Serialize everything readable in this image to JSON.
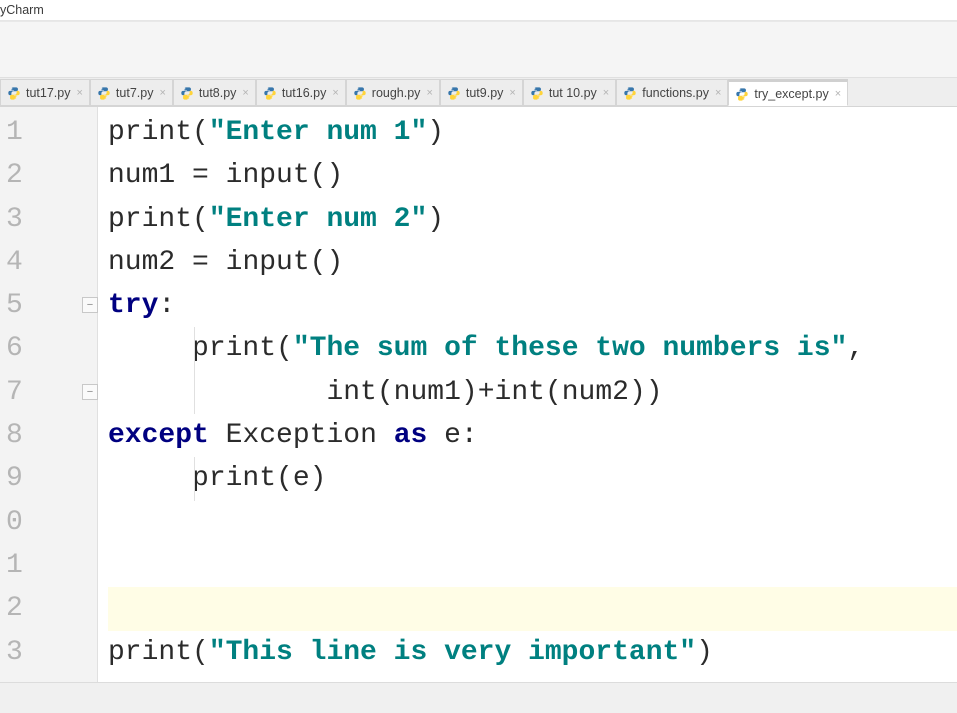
{
  "app": {
    "title": "yCharm"
  },
  "tabs": [
    {
      "label": "tut17.py",
      "active": false
    },
    {
      "label": "tut7.py",
      "active": false
    },
    {
      "label": "tut8.py",
      "active": false
    },
    {
      "label": "tut16.py",
      "active": false
    },
    {
      "label": "rough.py",
      "active": false
    },
    {
      "label": "tut9.py",
      "active": false
    },
    {
      "label": "tut 10.py",
      "active": false
    },
    {
      "label": "functions.py",
      "active": false
    },
    {
      "label": "try_except.py",
      "active": true
    }
  ],
  "close_glyph": "×",
  "fold_glyph": "−",
  "editor": {
    "current_line_index": 11,
    "line_numbers": [
      "1",
      "2",
      "3",
      "4",
      "5",
      "6",
      "7",
      "8",
      "9",
      "0",
      "1",
      "2",
      "3"
    ],
    "fold_markers": [
      4,
      6
    ],
    "lines": [
      {
        "tokens": [
          {
            "t": "print",
            "c": "id"
          },
          {
            "t": "(",
            "c": "pn"
          },
          {
            "t": "\"Enter num 1\"",
            "c": "str"
          },
          {
            "t": ")",
            "c": "pn"
          }
        ]
      },
      {
        "tokens": [
          {
            "t": "num1 ",
            "c": "id"
          },
          {
            "t": "=",
            "c": "op"
          },
          {
            "t": " ",
            "c": "id"
          },
          {
            "t": "input",
            "c": "id"
          },
          {
            "t": "()",
            "c": "pn"
          }
        ]
      },
      {
        "tokens": [
          {
            "t": "print",
            "c": "id"
          },
          {
            "t": "(",
            "c": "pn"
          },
          {
            "t": "\"Enter num 2\"",
            "c": "str"
          },
          {
            "t": ")",
            "c": "pn"
          }
        ]
      },
      {
        "tokens": [
          {
            "t": "num2 ",
            "c": "id"
          },
          {
            "t": "=",
            "c": "op"
          },
          {
            "t": " ",
            "c": "id"
          },
          {
            "t": "input",
            "c": "id"
          },
          {
            "t": "()",
            "c": "pn"
          }
        ]
      },
      {
        "tokens": [
          {
            "t": "try",
            "c": "kw"
          },
          {
            "t": ":",
            "c": "pn"
          }
        ]
      },
      {
        "indent": 1,
        "guide": true,
        "tokens": [
          {
            "t": "print",
            "c": "id"
          },
          {
            "t": "(",
            "c": "pn"
          },
          {
            "t": "\"The sum of these two numbers is\"",
            "c": "str"
          },
          {
            "t": ",",
            "c": "pn"
          }
        ]
      },
      {
        "indent": 1,
        "guide": true,
        "extra_indent": "        ",
        "tokens": [
          {
            "t": "int",
            "c": "id"
          },
          {
            "t": "(",
            "c": "pn"
          },
          {
            "t": "num1",
            "c": "id"
          },
          {
            "t": ")",
            "c": "pn"
          },
          {
            "t": "+",
            "c": "op"
          },
          {
            "t": "int",
            "c": "id"
          },
          {
            "t": "(",
            "c": "pn"
          },
          {
            "t": "num2",
            "c": "id"
          },
          {
            "t": ")",
            "c": "pn"
          },
          {
            "t": ")",
            "c": "pn"
          }
        ]
      },
      {
        "tokens": [
          {
            "t": "except",
            "c": "kw"
          },
          {
            "t": " ",
            "c": "id"
          },
          {
            "t": "Exception",
            "c": "cls"
          },
          {
            "t": " ",
            "c": "id"
          },
          {
            "t": "as",
            "c": "kw"
          },
          {
            "t": " e",
            "c": "id"
          },
          {
            "t": ":",
            "c": "pn"
          }
        ]
      },
      {
        "indent": 1,
        "guide": true,
        "tokens": [
          {
            "t": "print",
            "c": "id"
          },
          {
            "t": "(",
            "c": "pn"
          },
          {
            "t": "e",
            "c": "id"
          },
          {
            "t": ")",
            "c": "pn"
          }
        ]
      },
      {
        "tokens": []
      },
      {
        "tokens": []
      },
      {
        "tokens": []
      },
      {
        "tokens": [
          {
            "t": "print",
            "c": "id"
          },
          {
            "t": "(",
            "c": "pn"
          },
          {
            "t": "\"This line is very important\"",
            "c": "str"
          },
          {
            "t": ")",
            "c": "pn"
          }
        ]
      }
    ]
  }
}
